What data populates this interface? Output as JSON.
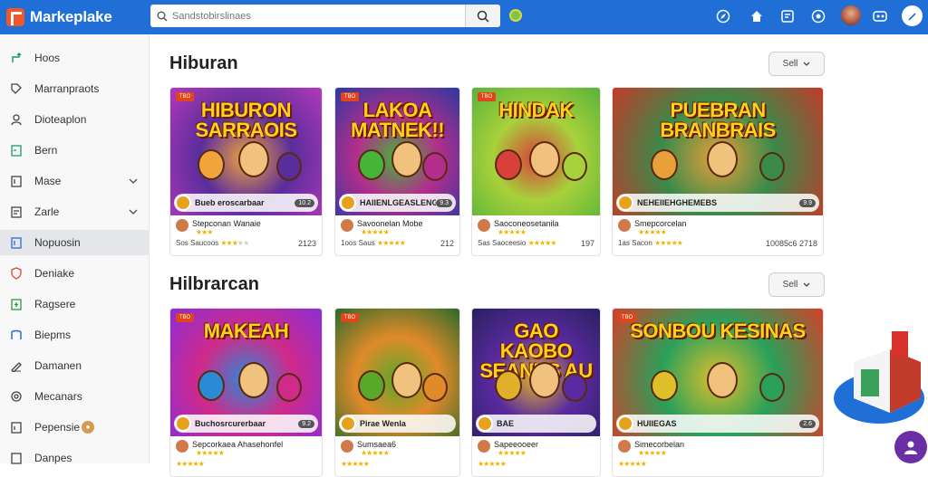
{
  "app": {
    "title": "Markeplake"
  },
  "search": {
    "placeholder": "Sandstobirslinaes"
  },
  "sidebar": {
    "items": [
      {
        "label": "Hoos",
        "icon": "route-icon"
      },
      {
        "label": "Marranpraots",
        "icon": "tag-icon"
      },
      {
        "label": "Dioteaplon",
        "icon": "user-icon"
      },
      {
        "label": "Bern",
        "icon": "book-icon"
      },
      {
        "label": "Mase",
        "icon": "document-icon"
      },
      {
        "label": "Zarle",
        "icon": "file-icon"
      },
      {
        "label": "Nopuosin",
        "icon": "card-icon"
      },
      {
        "label": "Deniake",
        "icon": "shield-icon"
      },
      {
        "label": "Ragsere",
        "icon": "plus-box-icon"
      },
      {
        "label": "Biepms",
        "icon": "tray-icon"
      },
      {
        "label": "Damanen",
        "icon": "pen-icon"
      },
      {
        "label": "Mecanars",
        "icon": "gear-icon"
      },
      {
        "label": "Pepensie",
        "icon": "list-icon"
      },
      {
        "label": "Danpes",
        "icon": "page-icon"
      }
    ]
  },
  "sections": [
    {
      "title": "Hiburan",
      "sort_label": "Sell",
      "cards": [
        {
          "thumb_title": "HIBURON SARRAOIS",
          "tag": "TBO",
          "foot": "Bueb eroscarbaar",
          "foot_num": "10.2",
          "meta_title": "Stepconan Wanaie",
          "meta_sub": "Sos Saucoos",
          "rating": 3,
          "count": "2123",
          "colors": [
            "#b23ab8",
            "#5a2d9c",
            "#f2a43c"
          ]
        },
        {
          "thumb_title": "LAKOA MATNEK!!",
          "tag": "TBO",
          "foot": "HAIIENLGEASLENGEA",
          "foot_num": "9.3",
          "meta_title": "Savoonelan Mobe",
          "meta_sub": "1oos Saus",
          "rating": 5,
          "count": "212",
          "colors": [
            "#2a3aa0",
            "#b22d8c",
            "#45b53a"
          ]
        },
        {
          "thumb_title": "HINDAK",
          "tag": "TBO",
          "foot": "",
          "foot_num": "",
          "meta_title": "Saoconeosetanila",
          "meta_sub": "Sas Saoceesio",
          "rating": 5,
          "count": "197",
          "colors": [
            "#59b23a",
            "#a8d13b",
            "#d8403a"
          ]
        },
        {
          "thumb_title": "PUEBRAN BRANBRAIS",
          "tag": "",
          "foot": "NEHEIIEHGHEMEBS",
          "foot_num": "9.9",
          "meta_title": "Smepcorcelan",
          "meta_sub": "1as Sacon",
          "rating": 5,
          "count": "10085c6 2718",
          "colors": [
            "#c33a2a",
            "#3a8a4a",
            "#e8a03a"
          ]
        }
      ]
    },
    {
      "title": "Hilbrarcan",
      "sort_label": "Sell",
      "cards": [
        {
          "thumb_title": "MAKEAH",
          "tag": "TBO",
          "foot": "Buchosrcurerbaar",
          "foot_num": "9.2",
          "meta_title": "Sepcorkaea Ahasehonfel",
          "meta_sub": "",
          "rating": 5,
          "count": "",
          "colors": [
            "#8a2ed6",
            "#d02a8a",
            "#2a8ad6"
          ]
        },
        {
          "thumb_title": "",
          "tag": "TBO",
          "foot": "Pirae Wenla",
          "foot_num": "",
          "meta_title": "Sumsaea6",
          "meta_sub": "",
          "rating": 5,
          "count": "",
          "colors": [
            "#2a6a2a",
            "#e08a2a",
            "#5aa82a"
          ]
        },
        {
          "thumb_title": "GAO KAOBO SEANKS AU",
          "tag": "",
          "foot": "BAE",
          "foot_num": "",
          "meta_title": "Sapeeooeer",
          "meta_sub": "",
          "rating": 5,
          "count": "",
          "colors": [
            "#2a2060",
            "#5a2aa0",
            "#e0b02a"
          ]
        },
        {
          "thumb_title": "SONBOU KESINAS",
          "tag": "TBO",
          "foot": "HUIIEGAS",
          "foot_num": "2.6",
          "meta_title": "Simecorbelan",
          "meta_sub": "",
          "rating": 5,
          "count": "",
          "colors": [
            "#d2402a",
            "#2aa05a",
            "#e0c02a"
          ]
        }
      ]
    }
  ],
  "colors": {
    "topbar": "#1f6fd6",
    "logo": "#f0572a",
    "fab": "#6b2ea5",
    "star": "#f0b400"
  }
}
